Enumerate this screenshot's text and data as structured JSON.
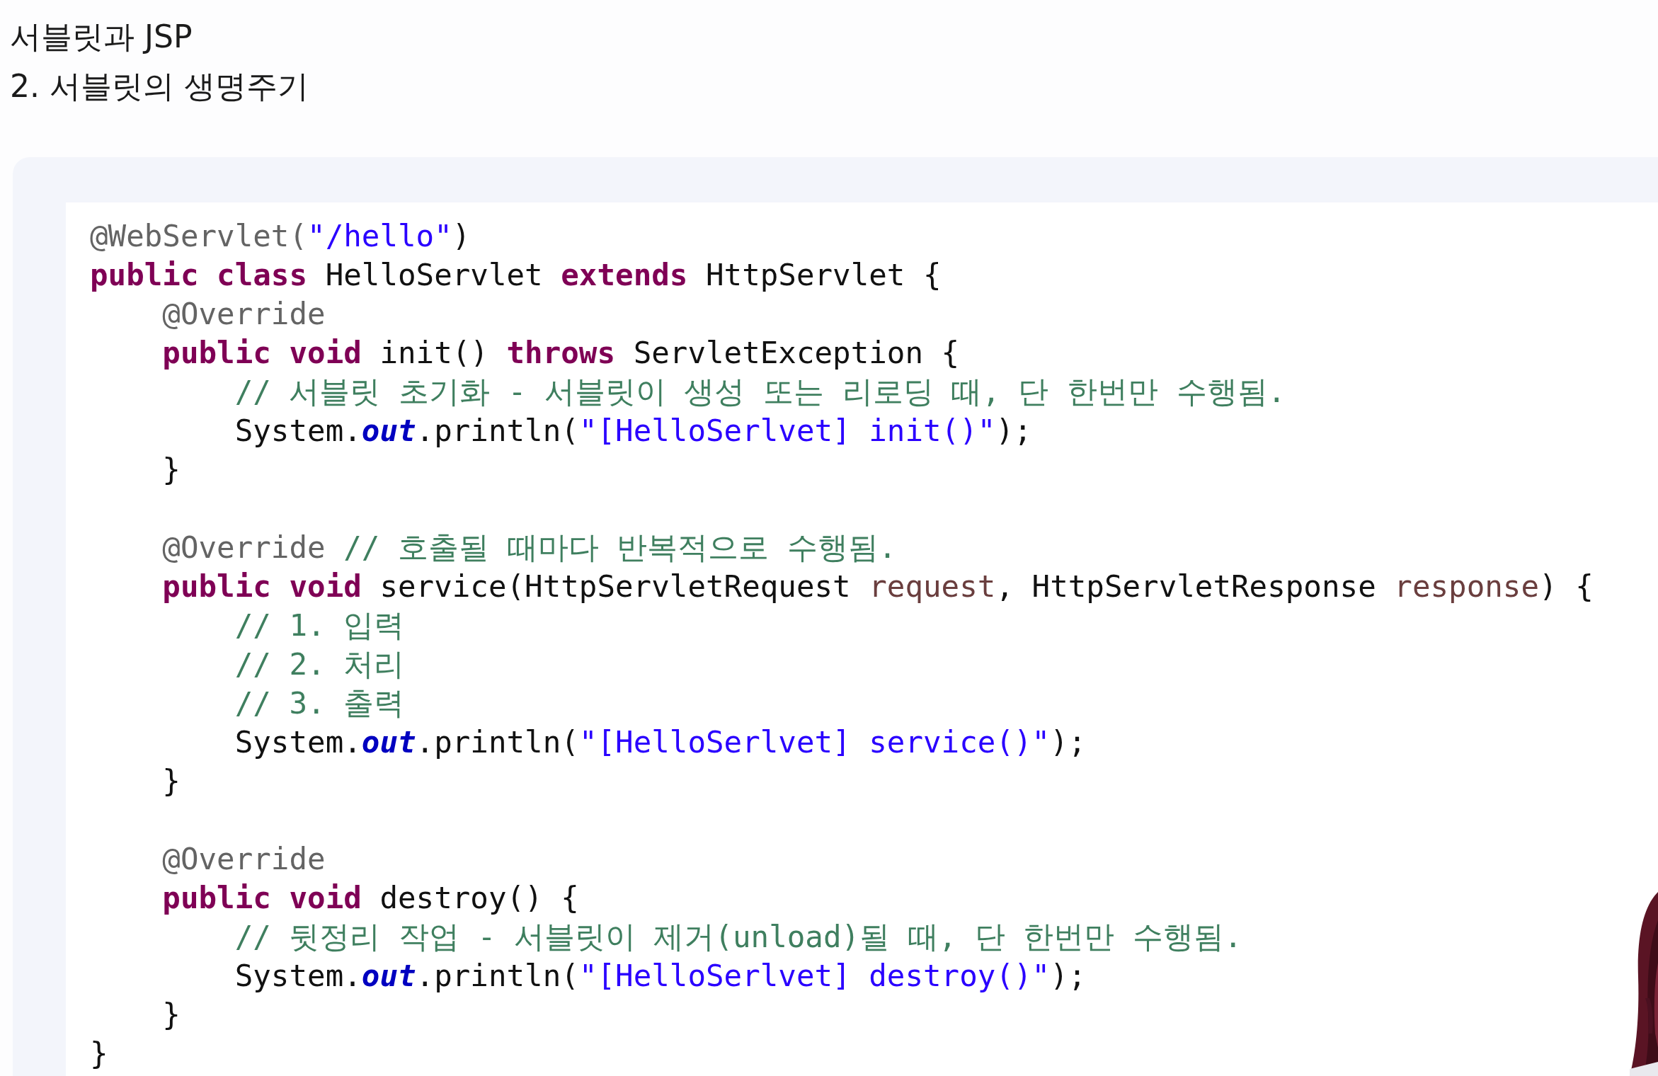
{
  "titles": [
    "서블릿과 JSP",
    "2. 서블릿의 생명주기"
  ],
  "code": [
    {
      "kind": "code",
      "tokens": [
        {
          "kind": "annotation",
          "text": "@WebServlet("
        },
        {
          "kind": "string",
          "text": "\"/hello\""
        },
        {
          "kind": "plain",
          "text": ")"
        }
      ]
    },
    {
      "kind": "code",
      "tokens": [
        {
          "kind": "keyword",
          "text": "public class"
        },
        {
          "kind": "plain",
          "text": " HelloServlet "
        },
        {
          "kind": "keyword",
          "text": "extends"
        },
        {
          "kind": "plain",
          "text": " HttpServlet {"
        }
      ]
    },
    {
      "kind": "code",
      "tokens": [
        {
          "kind": "annotation",
          "text": "    @Override"
        }
      ]
    },
    {
      "kind": "code",
      "tokens": [
        {
          "kind": "keyword",
          "text": "    public void"
        },
        {
          "kind": "plain",
          "text": " init() "
        },
        {
          "kind": "keyword",
          "text": "throws"
        },
        {
          "kind": "plain",
          "text": " ServletException {"
        }
      ]
    },
    {
      "kind": "code",
      "tokens": [
        {
          "kind": "comment",
          "text": "        // 서블릿 초기화 - 서블릿이 생성 또는 리로딩 때, 단 한번만 수행됨."
        }
      ]
    },
    {
      "kind": "code",
      "tokens": [
        {
          "kind": "plain",
          "text": "        System."
        },
        {
          "kind": "field",
          "text": "out"
        },
        {
          "kind": "plain",
          "text": ".println("
        },
        {
          "kind": "string",
          "text": "\"[HelloSerlvet] init()\""
        },
        {
          "kind": "plain",
          "text": ");"
        }
      ]
    },
    {
      "kind": "code",
      "tokens": [
        {
          "kind": "plain",
          "text": "    }"
        }
      ]
    },
    {
      "kind": "blank"
    },
    {
      "kind": "code",
      "tokens": [
        {
          "kind": "annotation",
          "text": "    @Override"
        },
        {
          "kind": "comment",
          "text": " // 호출될 때마다 반복적으로 수행됨."
        }
      ]
    },
    {
      "kind": "code",
      "tokens": [
        {
          "kind": "keyword",
          "text": "    public void"
        },
        {
          "kind": "plain",
          "text": " service(HttpServletRequest "
        },
        {
          "kind": "param",
          "text": "request"
        },
        {
          "kind": "plain",
          "text": ", HttpServletResponse "
        },
        {
          "kind": "param",
          "text": "response"
        },
        {
          "kind": "plain",
          "text": ") {"
        }
      ]
    },
    {
      "kind": "code",
      "tokens": [
        {
          "kind": "comment",
          "text": "        // 1. 입력"
        }
      ]
    },
    {
      "kind": "code",
      "tokens": [
        {
          "kind": "comment",
          "text": "        // 2. 처리"
        }
      ]
    },
    {
      "kind": "code",
      "tokens": [
        {
          "kind": "comment",
          "text": "        // 3. 출력"
        }
      ]
    },
    {
      "kind": "code",
      "tokens": [
        {
          "kind": "plain",
          "text": "        System."
        },
        {
          "kind": "field",
          "text": "out"
        },
        {
          "kind": "plain",
          "text": ".println("
        },
        {
          "kind": "string",
          "text": "\"[HelloSerlvet] service()\""
        },
        {
          "kind": "plain",
          "text": ");"
        }
      ]
    },
    {
      "kind": "code",
      "tokens": [
        {
          "kind": "plain",
          "text": "    }"
        }
      ]
    },
    {
      "kind": "blank"
    },
    {
      "kind": "code",
      "tokens": [
        {
          "kind": "annotation",
          "text": "    @Override"
        }
      ]
    },
    {
      "kind": "code",
      "tokens": [
        {
          "kind": "keyword",
          "text": "    public void"
        },
        {
          "kind": "plain",
          "text": " destroy() {"
        }
      ]
    },
    {
      "kind": "code",
      "tokens": [
        {
          "kind": "comment",
          "text": "        // 뒷정리 작업 - 서블릿이 제거(unload)될 때, 단 한번만 수행됨."
        }
      ]
    },
    {
      "kind": "code",
      "tokens": [
        {
          "kind": "plain",
          "text": "        System."
        },
        {
          "kind": "field",
          "text": "out"
        },
        {
          "kind": "plain",
          "text": ".println("
        },
        {
          "kind": "string",
          "text": "\"[HelloSerlvet] destroy()\""
        },
        {
          "kind": "plain",
          "text": ");"
        }
      ]
    },
    {
      "kind": "code",
      "tokens": [
        {
          "kind": "plain",
          "text": "    }"
        }
      ]
    },
    {
      "kind": "code",
      "tokens": [
        {
          "kind": "plain",
          "text": "}"
        }
      ]
    }
  ],
  "presenter": {
    "kind": "picture"
  }
}
